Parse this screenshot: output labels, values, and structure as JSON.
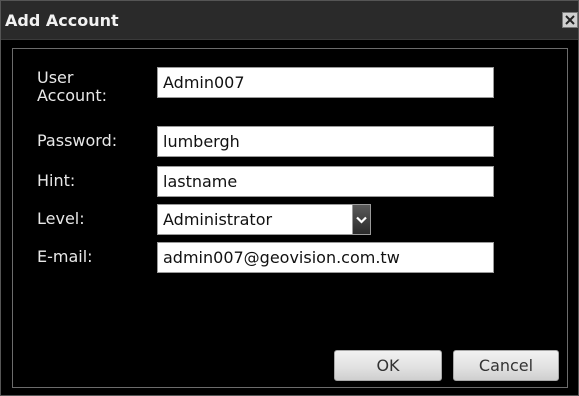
{
  "dialog": {
    "title": "Add Account",
    "close_icon": "close-icon"
  },
  "form": {
    "user_account_label": "User Account:",
    "user_account_value": "Admin007",
    "password_label": "Password:",
    "password_value": "lumbergh",
    "hint_label": "Hint:",
    "hint_value": "lastname",
    "level_label": "Level:",
    "level_value": "Administrator",
    "level_dropdown_icon": "chevron-down-icon",
    "email_label": "E-mail:",
    "email_value": "admin007@geovision.com.tw"
  },
  "buttons": {
    "ok_label": "OK",
    "cancel_label": "Cancel"
  }
}
